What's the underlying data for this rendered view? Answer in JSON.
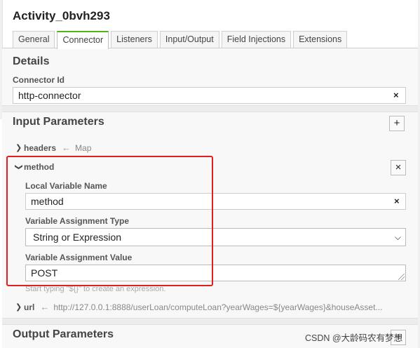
{
  "header": {
    "title": "Activity_0bvh293"
  },
  "tabs": [
    {
      "label": "General",
      "active": false
    },
    {
      "label": "Connector",
      "active": true
    },
    {
      "label": "Listeners",
      "active": false
    },
    {
      "label": "Input/Output",
      "active": false
    },
    {
      "label": "Field Injections",
      "active": false
    },
    {
      "label": "Extensions",
      "active": false
    }
  ],
  "details": {
    "title": "Details",
    "connector_id_label": "Connector Id",
    "connector_id_value": "http-connector",
    "clear_glyph": "×"
  },
  "input_parameters": {
    "title": "Input Parameters",
    "add_glyph": "+",
    "items": {
      "headers": {
        "name": "headers",
        "type": "Map",
        "expanded": false
      },
      "method": {
        "name": "method",
        "expanded": true,
        "remove_glyph": "×",
        "local_variable_name_label": "Local Variable Name",
        "local_variable_name_value": "method",
        "assignment_type_label": "Variable Assignment Type",
        "assignment_type_value": "String or Expression",
        "assignment_value_label": "Variable Assignment Value",
        "assignment_value": "POST",
        "hint": "Start typing \"${}\" to create an expression."
      },
      "url": {
        "name": "url",
        "value": "http://127.0.0.1:8888/userLoan/computeLoan?yearWages=${yearWages}&houseAsset...",
        "expanded": false
      }
    }
  },
  "output_parameters": {
    "title": "Output Parameters",
    "add_glyph": "+"
  },
  "watermark": "CSDN @大龄码农有梦想",
  "colors": {
    "active_tab_accent": "#52b415",
    "highlight_border": "#e02020"
  },
  "icons": {
    "chevron_right": "chevron-right-icon",
    "chevron_down": "chevron-down-icon",
    "arrow_left": "arrow-left-icon"
  }
}
